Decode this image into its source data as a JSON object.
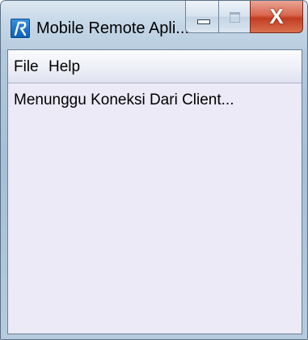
{
  "window": {
    "title": "Mobile Remote Apli...",
    "icon": "app-r-icon",
    "close_glyph": "X"
  },
  "menubar": {
    "items": [
      {
        "label": "File"
      },
      {
        "label": "Help"
      }
    ]
  },
  "main": {
    "status_text": "Menunggu Koneksi Dari Client..."
  },
  "colors": {
    "content_bg": "#ebeaf6",
    "close_button": "#c23d22",
    "icon_blue": "#0b5fb5"
  }
}
